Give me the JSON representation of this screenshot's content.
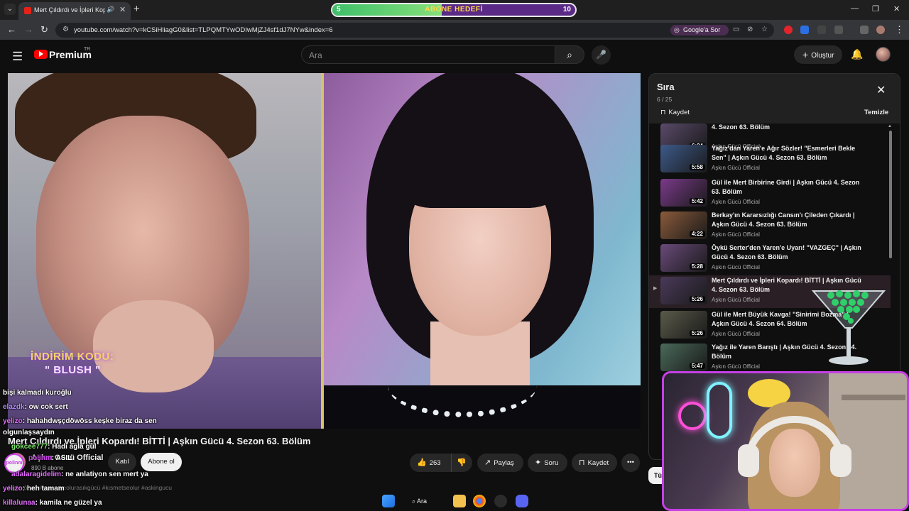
{
  "browser": {
    "tab_title": "Mert Çıldırdı ve İpleri Kopard",
    "tab_audio_icon": "speaker-icon",
    "url": "youtube.com/watch?v=kCSiHliagG0&list=TLPQMTYwODIwMjZJ4sf1dJ7NYw&index=6",
    "google_ask_label": "Google'a Sor"
  },
  "goal_bar": {
    "start": "5",
    "label": "ABONE HEDEFİ",
    "end": "10",
    "progress": 0.45,
    "fill_color": "#5fd27a",
    "bg_color": "#5a2a86"
  },
  "masthead": {
    "logo_text": "Premium",
    "country_code": "TR",
    "search_placeholder": "Ara",
    "create_label": "Oluştur"
  },
  "video": {
    "overlay_promo_line1": "İNDİRİM KODU:",
    "overlay_promo_line2": "\" BLUSH \"",
    "title": "Mert Çıldırdı ve İpleri Kopardı! BİTTİ | Aşkın Gücü 4. Sezon 63. Bölüm",
    "channel": "Aşkın Gücü Official",
    "subscribers": "890 B abone",
    "join_label": "Katıl",
    "subscribe_label": "Abone ol",
    "likes": "263",
    "share_label": "Paylaş",
    "ask_label": "Soru",
    "save_label": "Kaydet",
    "description_line": "4 gün önce  #kısmetseolurasıkgücü #kısmetseolur #askingucu"
  },
  "playlist": {
    "title": "Sıra",
    "position": "6 / 25",
    "save_label": "Kaydet",
    "clear_label": "Temizle",
    "items": [
      {
        "title": "4. Sezon 63. Bölüm",
        "channel": "Aşkın Gücü Official",
        "duration": "6:24",
        "active": false
      },
      {
        "title": "Yağız'dan Yaren'e Ağır Sözler! \"Esmerleri Bekle Sen\" | Aşkın Gücü 4. Sezon 63. Bölüm",
        "channel": "Aşkın Gücü Official",
        "duration": "5:58",
        "active": false
      },
      {
        "title": "Gül ile Mert Birbirine Girdi | Aşkın Gücü 4. Sezon 63. Bölüm",
        "channel": "Aşkın Gücü Official",
        "duration": "5:42",
        "active": false
      },
      {
        "title": "Berkay'ın Kararsızlığı Cansın'ı Çileden Çıkardı | Aşkın Gücü 4. Sezon 63. Bölüm",
        "channel": "Aşkın Gücü Official",
        "duration": "4:22",
        "active": false
      },
      {
        "title": "Öykü Serter'den Yaren'e Uyarı! \"VAZGEÇ\" | Aşkın Gücü 4. Sezon 63. Bölüm",
        "channel": "Aşkın Gücü Official",
        "duration": "5:28",
        "active": false
      },
      {
        "title": "Mert Çıldırdı ve İpleri Kopardı! BİTTİ | Aşkın Gücü 4. Sezon 63. Bölüm",
        "channel": "Aşkın Gücü Official",
        "duration": "5:26",
        "active": true
      },
      {
        "title": "Gül ile Mert Büyük Kavga! \"Sinirimi Bozma\" | Aşkın Gücü 4. Sezon 64. Bölüm",
        "channel": "Aşkın Gücü Official",
        "duration": "5:26",
        "active": false
      },
      {
        "title": "Yağız ile Yaren Barıştı | Aşkın Gücü 4. Sezon 64. Bölüm",
        "channel": "Aşkın Gücü Official",
        "duration": "5:47",
        "active": false
      }
    ],
    "thumb_colors": [
      "#5a4a6a",
      "#3d5a8a",
      "#7a3a8a",
      "#8a5a3a",
      "#6a4a7a",
      "#4a3a5a",
      "#5a5a4a",
      "#4a6a5a"
    ]
  },
  "chip_label": "Tü",
  "chat": [
    {
      "user": "",
      "text": "bişi kalmadı kuroğlu",
      "color": "#ffffff"
    },
    {
      "user": "elazdk",
      "text": ": ow cok sert",
      "color": "#b38cff"
    },
    {
      "user": "yelizo",
      "text": ": hahahdwşçdöwöss keşke biraz da sen",
      "color": "#e46dff"
    },
    {
      "user": "",
      "text": "olgunlaşsaydın",
      "color": "#ffffff"
    },
    {
      "user": "gokcee777",
      "text": ": Hadi ağla gül",
      "color": "#7de36d"
    },
    {
      "user": "polinm",
      "text": ": ASIL",
      "color": "#c63fe6"
    },
    {
      "user": "adalaragidelim",
      "text": ": ne anlatiyon sen mert ya",
      "color": "#e46dff"
    },
    {
      "user": "yelizo",
      "text": ": heh tamam",
      "color": "#e46dff"
    },
    {
      "user": "killalunaa",
      "text": ": kamila ne güzel ya",
      "color": "#e46dff"
    }
  ],
  "taskbar": {
    "search_label": "Ara"
  }
}
